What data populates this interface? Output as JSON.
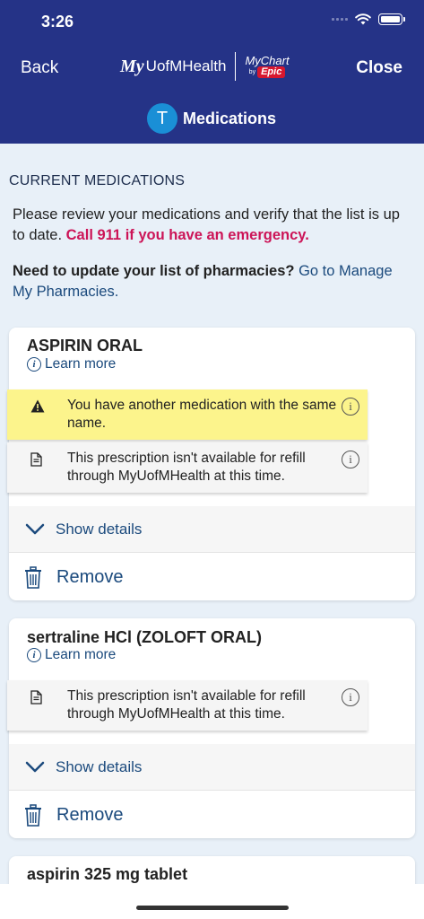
{
  "status_bar": {
    "time": "3:26"
  },
  "header": {
    "back_label": "Back",
    "close_label": "Close",
    "brand_my": "My",
    "brand_name": "UofMHealth",
    "mychart_label": "MyChart",
    "mychart_by": "by",
    "mychart_epic": "Epic",
    "avatar_initial": "T",
    "page_title": "Medications",
    "bg_color": "#253387"
  },
  "intro": {
    "section_title": "CURRENT MEDICATIONS",
    "review_text": "Please review your medications and verify that the list is up to date. ",
    "emergency_text": "Call 911 if you have an emergency.",
    "pharmacy_question": "Need to update your list of pharmacies?",
    "pharmacy_link": " Go to Manage My Pharmacies."
  },
  "medications": [
    {
      "name": "ASPIRIN ORAL",
      "learn_more": "Learn more",
      "warning": "You have another medication with the same name.",
      "note": "This prescription isn't available for refill through MyUofMHealth at this time.",
      "show_details": "Show details",
      "remove": "Remove"
    },
    {
      "name": "sertraline HCl (ZOLOFT ORAL)",
      "learn_more": "Learn more",
      "note": "This prescription isn't available for refill through MyUofMHealth at this time.",
      "show_details": "Show details",
      "remove": "Remove"
    },
    {
      "name": "aspirin 325 mg tablet"
    }
  ],
  "colors": {
    "link": "#1b4a7d",
    "emergency": "#cc1457",
    "warning_bg": "#fcf48c"
  }
}
